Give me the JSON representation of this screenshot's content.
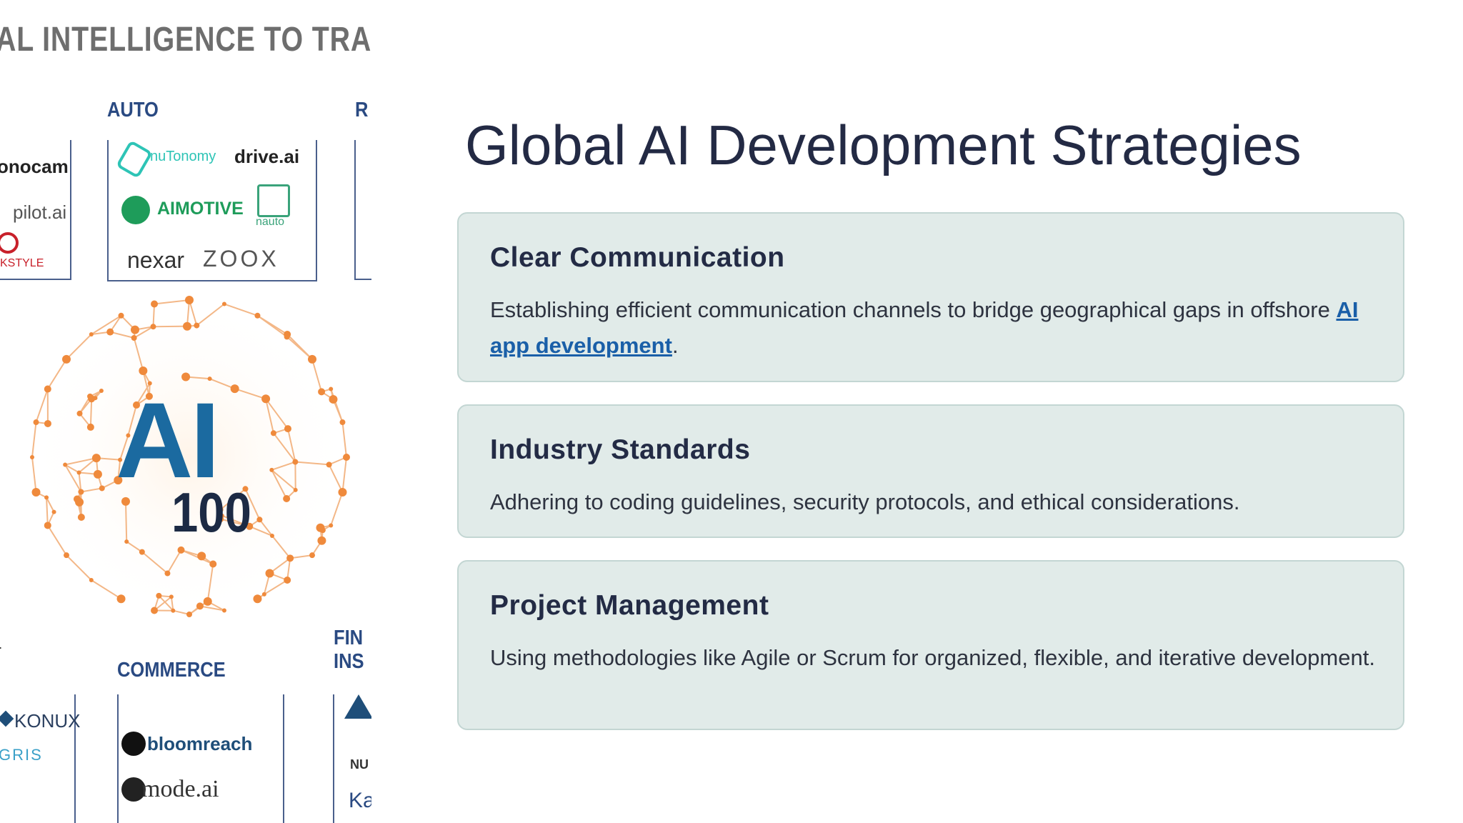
{
  "slide": {
    "title": "Global AI Development Strategies",
    "cards": [
      {
        "heading": "Clear Communication",
        "text_before_link": "Establishing efficient communication channels to bridge geographical gaps in offshore ",
        "link_text": "AI app development",
        "text_after_link": "."
      },
      {
        "heading": "Industry Standards",
        "text": "Adhering to coding guidelines, security protocols, and ethical considerations."
      },
      {
        "heading": "Project Management",
        "text": "Using methodologies like Agile or Scrum for organized, flexible, and iterative development."
      }
    ],
    "colors": {
      "title": "#232a44",
      "card_bg": "#e1ebe9",
      "card_border": "#c3d6d3",
      "link": "#1a5fa8"
    }
  },
  "image": {
    "banner": "AL INTELLIGENCE TO TRA",
    "categories": {
      "auto": "AUTO",
      "r_partial": "R",
      "commerce": "COMMERCE",
      "fin_partial": "FIN",
      "ins_partial": "INS"
    },
    "logos": {
      "onocam": "onocam",
      "pilot_ai": "pilot.ai",
      "kstyle": "KSTYLE",
      "nutonomy": "nuTonomy",
      "drive_ai": "drive.ai",
      "aimotive": "AIMOTIVE",
      "nauto": "nauto",
      "nexar": "nexar",
      "zoox": "ZOOX",
      "konux": "KONUX",
      "gris": "GRIS",
      "bloomreach": "bloomreach",
      "mode_ai": "mode.ai",
      "nu": "NU",
      "ka": "Ka"
    },
    "badge": {
      "big": "AI",
      "number": "100"
    },
    "colors": {
      "banner": "#6e6e6e",
      "category": "#2a4a82",
      "ai_text": "#1b6aa0",
      "globe": "#f0a060"
    }
  }
}
